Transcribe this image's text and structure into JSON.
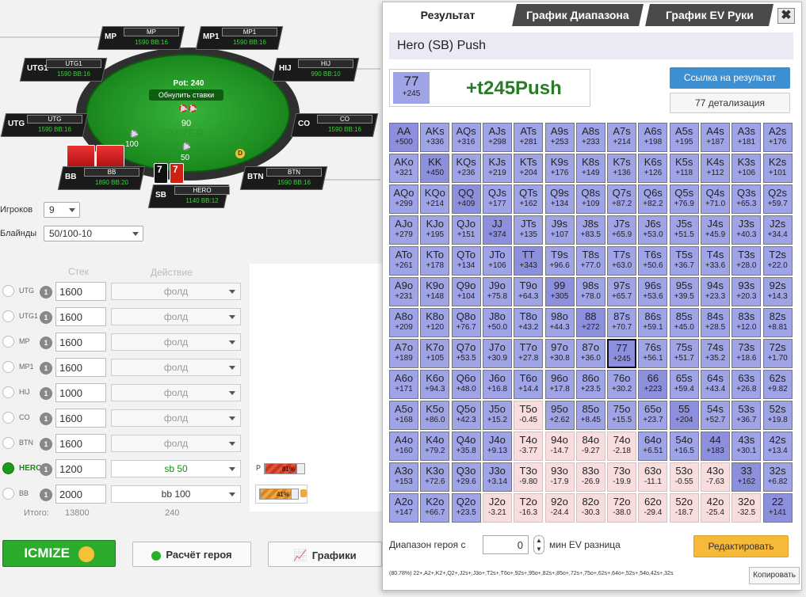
{
  "table": {
    "pot_label": "Pot: 240",
    "reset_label": "Обнулить ставки",
    "pot_chips": "90",
    "sb_chips": "50",
    "bb_chips": "100",
    "watermark": "ICMIZER",
    "dealer": "D",
    "hero_cards": [
      "7",
      "7"
    ],
    "seats": [
      {
        "pos": "MP",
        "label": "MP",
        "stack": "1590 BB:16"
      },
      {
        "pos": "MP1",
        "label": "MP1",
        "stack": "1590 BB:16"
      },
      {
        "pos": "UTG1",
        "label": "UTG1",
        "stack": "1590 BB:16"
      },
      {
        "pos": "HIJ",
        "label": "HIJ",
        "stack": "990 BB:10"
      },
      {
        "pos": "UTG",
        "label": "UTG",
        "stack": "1590 BB:16"
      },
      {
        "pos": "CO",
        "label": "CO",
        "stack": "1590 BB:16"
      },
      {
        "pos": "BB",
        "label": "BB",
        "stack": "1890 BB:20"
      },
      {
        "pos": "BTN",
        "label": "BTN",
        "stack": "1590 BB:16"
      },
      {
        "pos": "SB",
        "label": "HERO",
        "stack": "1140 BB:12"
      }
    ]
  },
  "controls": {
    "players_label": "Игроков",
    "players_value": "9",
    "blinds_label": "Блайнды",
    "blinds_value": "50/100-10",
    "stack_header": "Стек",
    "action_header": "Действие",
    "total_label": "Итого:",
    "total_stack": "13800",
    "total_action": "240"
  },
  "rows": [
    {
      "pos": "UTG",
      "badge": "1",
      "stack": "1600",
      "action": "фолд"
    },
    {
      "pos": "UTG1",
      "badge": "1",
      "stack": "1600",
      "action": "фолд"
    },
    {
      "pos": "MP",
      "badge": "1",
      "stack": "1600",
      "action": "фолд"
    },
    {
      "pos": "MP1",
      "badge": "1",
      "stack": "1600",
      "action": "фолд"
    },
    {
      "pos": "HIJ",
      "badge": "1",
      "stack": "1000",
      "action": "фолд"
    },
    {
      "pos": "CO",
      "badge": "1",
      "stack": "1600",
      "action": "фолд"
    },
    {
      "pos": "BTN",
      "badge": "1",
      "stack": "1600",
      "action": "фолд"
    },
    {
      "pos": "HERO",
      "badge": "1",
      "stack": "1200",
      "action": "sb 50"
    },
    {
      "pos": "BB",
      "badge": "1",
      "stack": "2000",
      "action": "bb 100"
    }
  ],
  "bars": {
    "p_label": "P",
    "p_value": "81%",
    "p_fraction": 0.81,
    "bb_value": "41%",
    "bb_fraction": 0.41
  },
  "buttons": {
    "icmize": "ICMIZE",
    "hero_calc": "Расчёт героя",
    "graphs": "Графики"
  },
  "panel": {
    "tabs": [
      "Результат",
      "График Диапазона",
      "График EV Руки"
    ],
    "close": "✖",
    "title": "Hero (SB) Push",
    "hand": "77",
    "hand_ev": "+245",
    "result": "+t245Push",
    "link_button": "Ссылка на результат",
    "detail_button": "77 детализация",
    "range_label": "Диапазон героя с",
    "range_value": "0",
    "range_suffix": "мин EV разница",
    "edit_button": "Редактировать",
    "range_string": "(80.78%) 22+,A2+,K2+,Q2+,J2s+,J3o+,T2s+,T6o+,92s+,95o+,82s+,85o+,72s+,75o+,62s+,64o+,52s+,54o,42s+,32s",
    "copy_button": "Копировать",
    "matrix": [
      [
        "AA",
        "+500",
        "AKs",
        "+336",
        "AQs",
        "+316",
        "AJs",
        "+298",
        "ATs",
        "+281",
        "A9s",
        "+253",
        "A8s",
        "+233",
        "A7s",
        "+214",
        "A6s",
        "+198",
        "A5s",
        "+195",
        "A4s",
        "+187",
        "A3s",
        "+181",
        "A2s",
        "+176"
      ],
      [
        "AKo",
        "+321",
        "KK",
        "+450",
        "KQs",
        "+236",
        "KJs",
        "+219",
        "KTs",
        "+204",
        "K9s",
        "+176",
        "K8s",
        "+149",
        "K7s",
        "+136",
        "K6s",
        "+126",
        "K5s",
        "+118",
        "K4s",
        "+112",
        "K3s",
        "+106",
        "K2s",
        "+101"
      ],
      [
        "AQo",
        "+299",
        "KQo",
        "+214",
        "QQ",
        "+409",
        "QJs",
        "+177",
        "QTs",
        "+162",
        "Q9s",
        "+134",
        "Q8s",
        "+109",
        "Q7s",
        "+87.2",
        "Q6s",
        "+82.2",
        "Q5s",
        "+76.9",
        "Q4s",
        "+71.0",
        "Q3s",
        "+65.3",
        "Q2s",
        "+59.7"
      ],
      [
        "AJo",
        "+279",
        "KJo",
        "+195",
        "QJo",
        "+151",
        "JJ",
        "+374",
        "JTs",
        "+135",
        "J9s",
        "+107",
        "J8s",
        "+83.5",
        "J7s",
        "+65.9",
        "J6s",
        "+53.0",
        "J5s",
        "+51.5",
        "J4s",
        "+45.9",
        "J3s",
        "+40.3",
        "J2s",
        "+34.4"
      ],
      [
        "ATo",
        "+261",
        "KTo",
        "+178",
        "QTo",
        "+134",
        "JTo",
        "+106",
        "TT",
        "+343",
        "T9s",
        "+96.6",
        "T8s",
        "+77.0",
        "T7s",
        "+63.0",
        "T6s",
        "+50.6",
        "T5s",
        "+36.7",
        "T4s",
        "+33.6",
        "T3s",
        "+28.0",
        "T2s",
        "+22.0"
      ],
      [
        "A9o",
        "+231",
        "K9o",
        "+148",
        "Q9o",
        "+104",
        "J9o",
        "+75.8",
        "T9o",
        "+64.3",
        "99",
        "+305",
        "98s",
        "+78.0",
        "97s",
        "+65.7",
        "96s",
        "+53.6",
        "95s",
        "+39.5",
        "94s",
        "+23.3",
        "93s",
        "+20.3",
        "92s",
        "+14.3"
      ],
      [
        "A8o",
        "+209",
        "K8o",
        "+120",
        "Q8o",
        "+76.7",
        "J8o",
        "+50.0",
        "T8o",
        "+43.2",
        "98o",
        "+44.3",
        "88",
        "+272",
        "87s",
        "+70.7",
        "86s",
        "+59.1",
        "85s",
        "+45.0",
        "84s",
        "+28.5",
        "83s",
        "+12.0",
        "82s",
        "+8.81"
      ],
      [
        "A7o",
        "+189",
        "K7o",
        "+105",
        "Q7o",
        "+53.5",
        "J7o",
        "+30.9",
        "T7o",
        "+27.8",
        "97o",
        "+30.8",
        "87o",
        "+36.0",
        "77",
        "+245",
        "76s",
        "+56.1",
        "75s",
        "+51.7",
        "74s",
        "+35.2",
        "73s",
        "+18.6",
        "72s",
        "+1.70"
      ],
      [
        "A6o",
        "+171",
        "K6o",
        "+94.3",
        "Q6o",
        "+48.0",
        "J6o",
        "+16.8",
        "T6o",
        "+14.4",
        "96o",
        "+17.8",
        "86o",
        "+23.5",
        "76o",
        "+30.2",
        "66",
        "+223",
        "65s",
        "+59.4",
        "64s",
        "+43.4",
        "63s",
        "+26.8",
        "62s",
        "+9.82"
      ],
      [
        "A5o",
        "+168",
        "K5o",
        "+86.0",
        "Q5o",
        "+42.3",
        "J5o",
        "+15.2",
        "T5o",
        "-0.45",
        "95o",
        "+2.62",
        "85o",
        "+8.45",
        "75o",
        "+15.5",
        "65o",
        "+23.7",
        "55",
        "+204",
        "54s",
        "+52.7",
        "53s",
        "+36.7",
        "52s",
        "+19.8"
      ],
      [
        "A4o",
        "+160",
        "K4o",
        "+79.2",
        "Q4o",
        "+35.8",
        "J4o",
        "+9.13",
        "T4o",
        "-3.77",
        "94o",
        "-14.7",
        "84o",
        "-9.27",
        "74o",
        "-2.18",
        "64o",
        "+6.51",
        "54o",
        "+16.5",
        "44",
        "+183",
        "43s",
        "+30.1",
        "42s",
        "+13.4"
      ],
      [
        "A3o",
        "+153",
        "K3o",
        "+72.6",
        "Q3o",
        "+29.6",
        "J3o",
        "+3.14",
        "T3o",
        "-9.80",
        "93o",
        "-17.9",
        "83o",
        "-26.9",
        "73o",
        "-19.9",
        "63o",
        "-11.1",
        "53o",
        "-0.55",
        "43o",
        "-7.63",
        "33",
        "+162",
        "32s",
        "+6.82"
      ],
      [
        "A2o",
        "+147",
        "K2o",
        "+66.7",
        "Q2o",
        "+23.5",
        "J2o",
        "-3.21",
        "T2o",
        "-16.3",
        "92o",
        "-24.4",
        "82o",
        "-30.3",
        "72o",
        "-38.0",
        "62o",
        "-29.4",
        "52o",
        "-18.7",
        "42o",
        "-25.4",
        "32o",
        "-32.5",
        "22",
        "+141"
      ]
    ]
  }
}
